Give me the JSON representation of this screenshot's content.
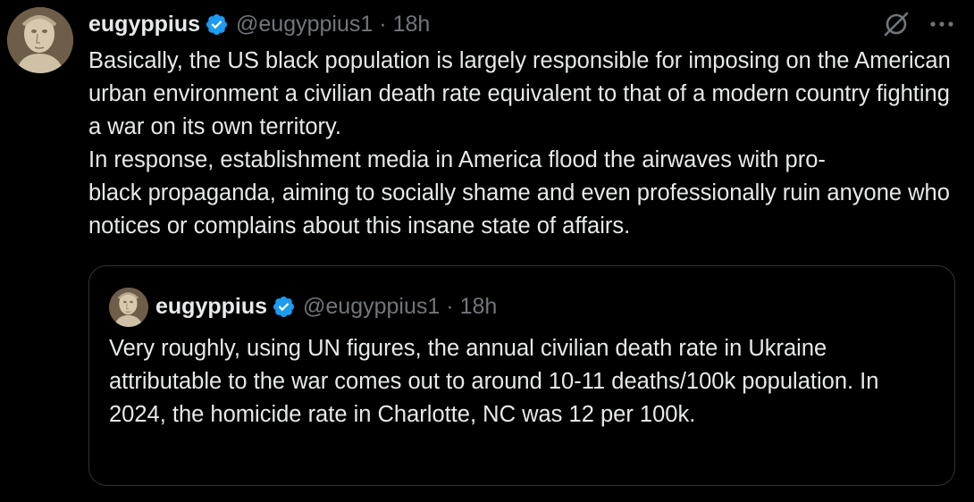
{
  "tweet": {
    "author_name": "eugyppius",
    "handle": "@eugyppius1",
    "separator": "·",
    "time": "18h",
    "avatar_icon": "portrait-avatar",
    "verified_icon": "verified-badge-icon",
    "grok_icon": "grok-icon",
    "more_icon": "more-options-icon",
    "paragraphs": [
      "Basically, the US black population is largely responsible for imposing on the American urban environment a civilian death rate equivalent to that of a modern country fighting a war on its own territory.",
      "In response, establishment media in America flood the airwaves with pro-\nblack propaganda, aiming to socially shame and even professionally ruin anyone who notices or complains about this insane state of affairs."
    ]
  },
  "quoted_tweet": {
    "author_name": "eugyppius",
    "handle": "@eugyppius1",
    "separator": "·",
    "time": "18h",
    "text": "Very roughly, using UN figures, the annual civilian death rate in Ukraine attributable to the war comes out to around 10-11 deaths/100k population. In 2024, the homicide rate in Charlotte, NC was 12 per 100k."
  },
  "colors": {
    "background": "#000000",
    "primary_text": "#e7e9ea",
    "secondary_text": "#71767b",
    "verified_blue": "#1d9bf0",
    "border": "#2f3336"
  }
}
